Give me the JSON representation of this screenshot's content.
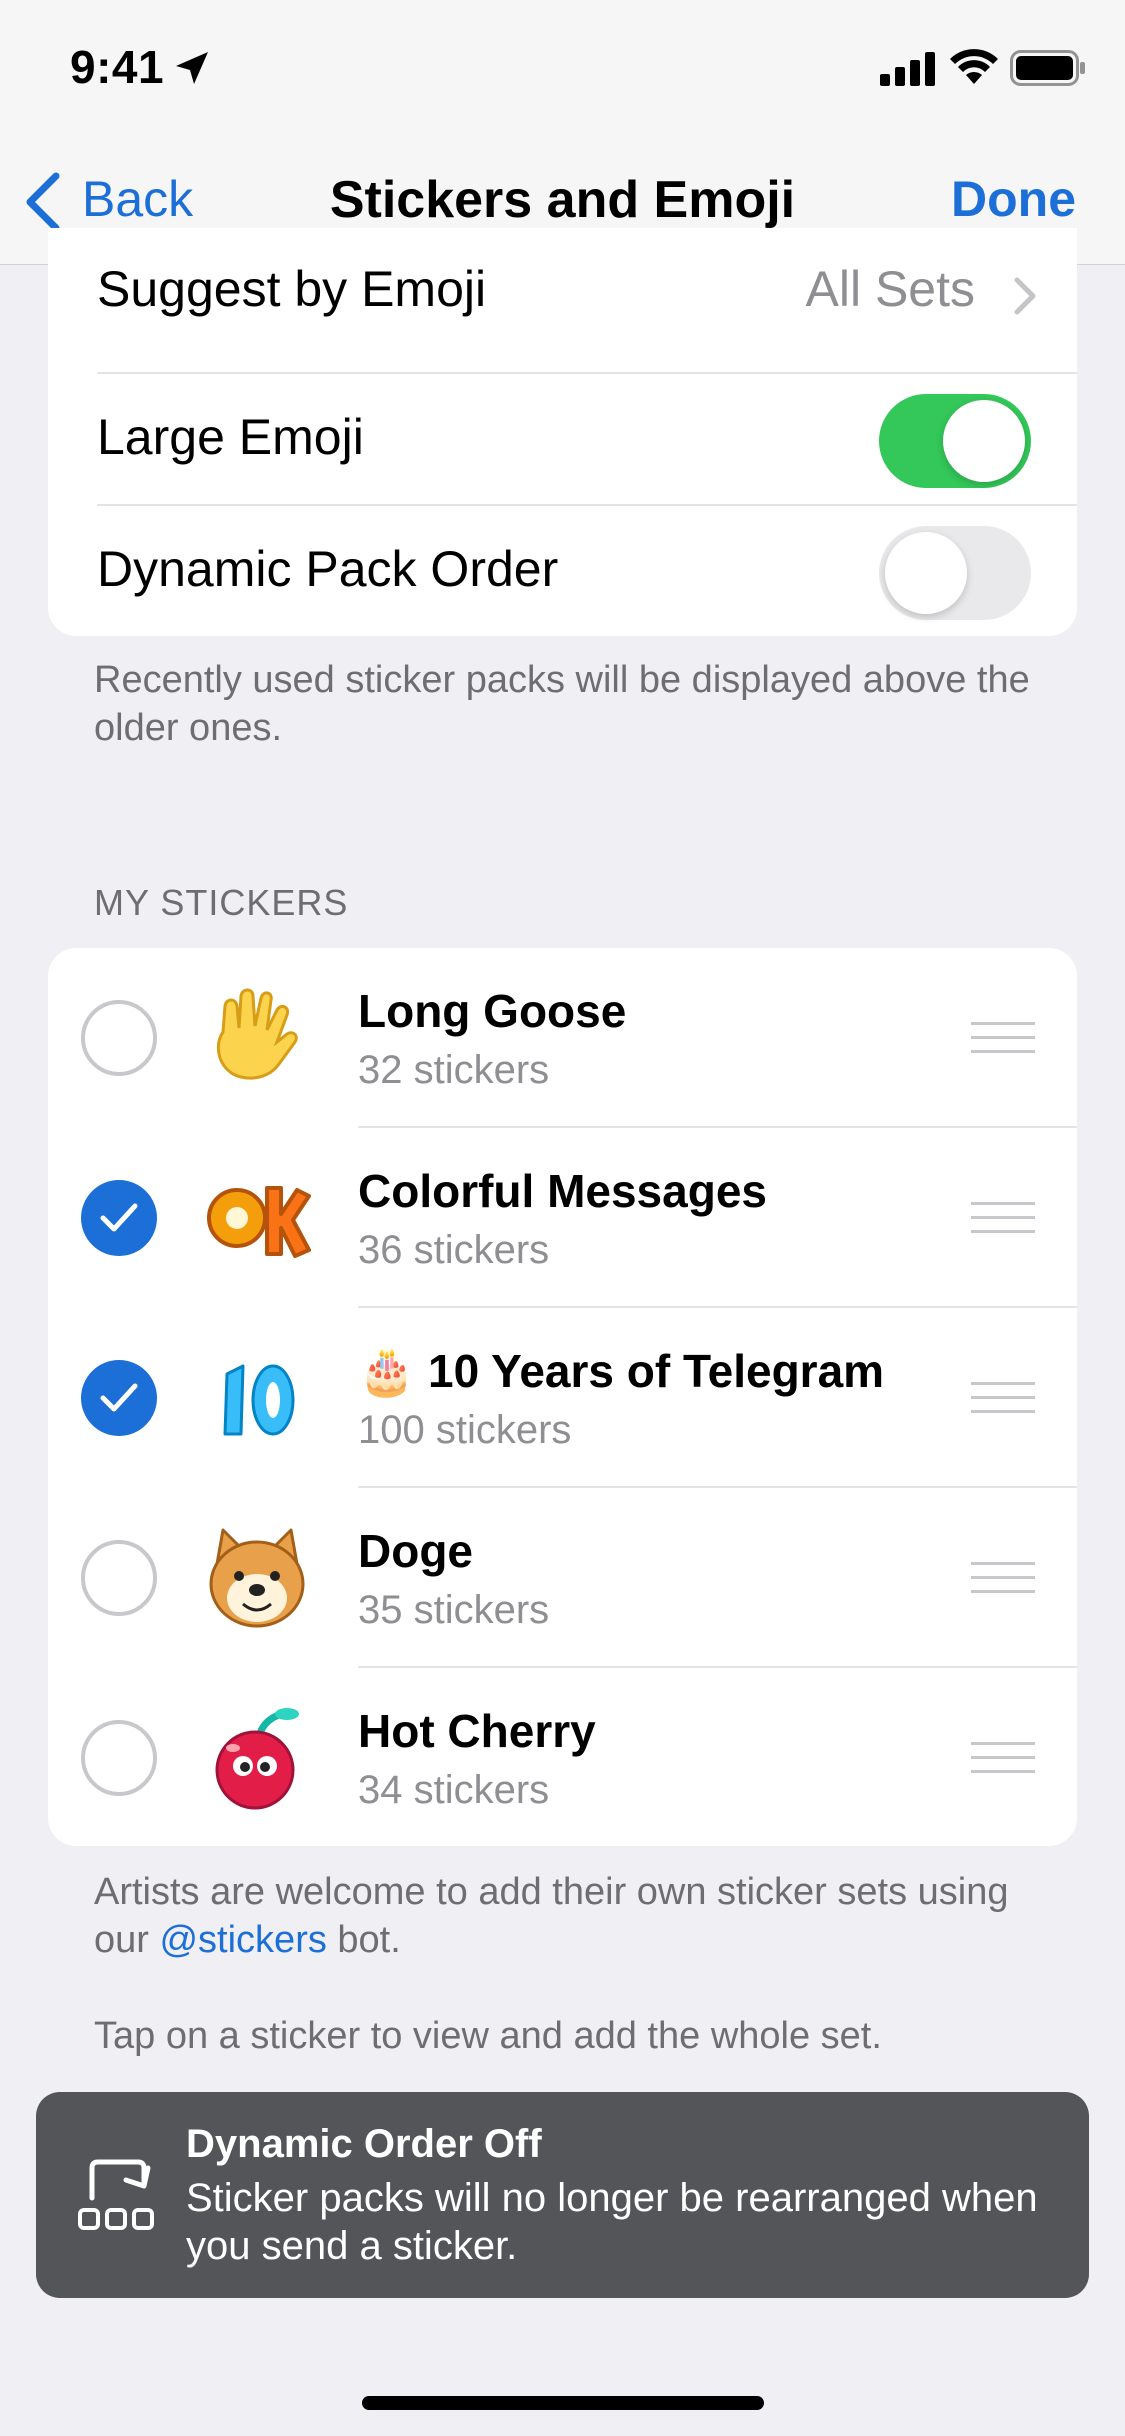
{
  "status_bar": {
    "time": "9:41"
  },
  "navbar": {
    "back_label": "Back",
    "title": "Stickers and Emoji",
    "done_label": "Done"
  },
  "settings": {
    "suggest_label": "Suggest by Emoji",
    "suggest_value": "All Sets",
    "large_emoji_label": "Large Emoji",
    "large_emoji_on": true,
    "dynamic_order_label": "Dynamic Pack Order",
    "dynamic_order_on": false,
    "footnote": "Recently used sticker packs will be displayed above the older ones."
  },
  "my_stickers": {
    "header": "MY STICKERS",
    "packs": [
      {
        "title": "Long Goose",
        "count": "32 stickers",
        "selected": false,
        "icon": "waving-hand-sticker"
      },
      {
        "title": "Colorful Messages",
        "count": "36 stickers",
        "selected": true,
        "icon": "ok-sticker"
      },
      {
        "title": "🎂 10 Years of Telegram",
        "count": "100 stickers",
        "selected": true,
        "icon": "number-10-sticker"
      },
      {
        "title": "Doge",
        "count": "35 stickers",
        "selected": false,
        "icon": "doge-sticker"
      },
      {
        "title": "Hot Cherry",
        "count": "34 stickers",
        "selected": false,
        "icon": "cherry-sticker"
      }
    ]
  },
  "footer": {
    "artists_prefix": "Artists are welcome to add their own sticker sets using our ",
    "artists_link": "@stickers",
    "artists_suffix": " bot.",
    "tap_hint": "Tap on a sticker to view and add the whole set."
  },
  "toast": {
    "title": "Dynamic Order Off",
    "body": "Sticker packs will no longer be rearranged when you send a sticker."
  },
  "colors": {
    "accent": "#1c6fd6",
    "toggle_on": "#34c759",
    "background": "#efeff4"
  }
}
